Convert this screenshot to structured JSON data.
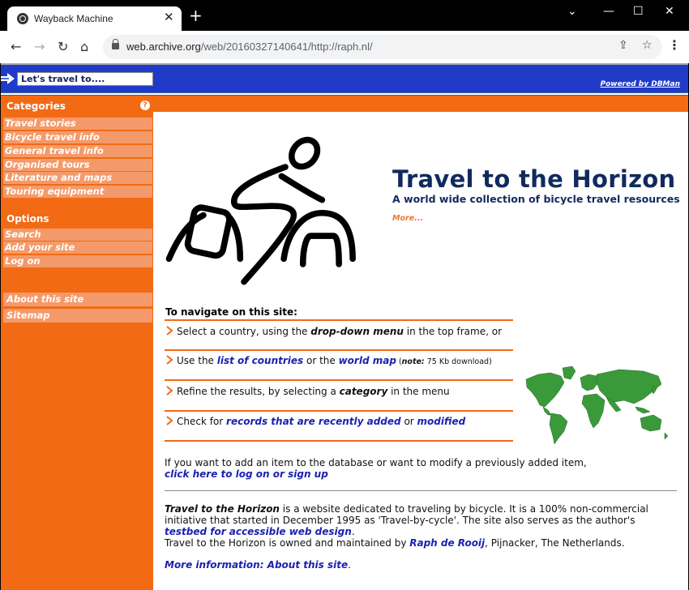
{
  "browser": {
    "tab_title": "Wayback Machine",
    "tab_close": "✕",
    "new_tab": "+",
    "url_host": "web.archive.org",
    "url_path": "/web/20160327140641/http://raph.nl/",
    "window_controls": [
      "⌄",
      "—",
      "☐",
      "✕"
    ]
  },
  "topframe": {
    "select_value": "Let's travel to....",
    "powered_by": "Powered by DBMan"
  },
  "sidebar": {
    "categories_heading": "Categories",
    "help": "?",
    "categories": [
      {
        "label": "Travel stories"
      },
      {
        "label": "Bicycle travel info"
      },
      {
        "label": "General travel info"
      },
      {
        "label": "Organised tours"
      },
      {
        "label": "Literature and maps"
      },
      {
        "label": "Touring equipment"
      }
    ],
    "options_heading": "Options",
    "options": [
      {
        "label": "Search"
      },
      {
        "label": "Add your site"
      },
      {
        "label": "Log on"
      }
    ],
    "extra": [
      {
        "label": "About this site"
      },
      {
        "label": "Sitemap"
      }
    ]
  },
  "main": {
    "title": "Travel to the Horizon",
    "subtitle": "A world wide collection of bicycle travel resources",
    "more_link": "More...",
    "nav_heading": "To navigate on this site:",
    "nav_items": [
      {
        "pre": "Select a country, using the ",
        "em": "drop-down menu",
        "post": " in the top frame, or"
      },
      {
        "pre": "Use the ",
        "link1": "list of countries",
        "mid": " or the ",
        "link2": "world map",
        "note_open": " (",
        "note_label": "note:",
        "note_text": " 75 Kb download)"
      },
      {
        "pre": "Refine the results, by selecting a ",
        "em": "category",
        "post": " in the menu"
      },
      {
        "pre": "Check for ",
        "link1": "records that are recently added",
        "mid": " or ",
        "link2": "modified"
      }
    ],
    "add_item_text": "If you want to add an item to the database or want to modify a previously added item,",
    "add_item_link": "click here to log on or sign up",
    "about": {
      "title_em": "Travel to the Horizon",
      "text1": " is a website dedicated to traveling by bicycle. It is a 100% non-commercial initiative that started in December 1995 as 'Travel-by-cycle'. The site also serves as the author's",
      "testbed_link": "testbed for accessible web design",
      "period": ".",
      "owner_pre": "Travel to the Horizon is owned and maintained by ",
      "owner_link": "Raph de Rooij",
      "owner_post": ", Pijnacker, The Netherlands.",
      "more_info_link": "More information: About this site",
      "more_info_period": "."
    }
  },
  "colors": {
    "blue_frame": "#1f3bc8",
    "orange": "#f26a14",
    "sidebar_item": "#f49a6a",
    "title_navy": "#112a5e",
    "link_blue": "#1a22b0",
    "map_green": "#3a9a3a"
  }
}
